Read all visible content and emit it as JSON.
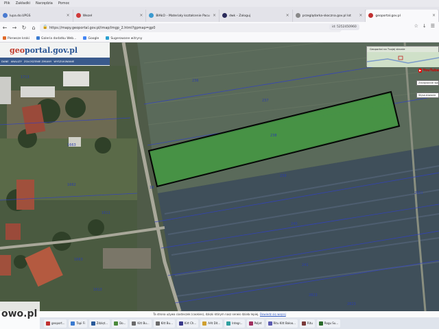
{
  "menubar": {
    "items": [
      "Plik",
      "Zakładki",
      "Narzędzia",
      "Pomoc"
    ]
  },
  "tabs": [
    {
      "label": "lupa.do.UPGS",
      "color": "#4a7bd0",
      "active": false
    },
    {
      "label": "Wezeł",
      "color": "#d03a3a",
      "active": false
    },
    {
      "label": "BIAŁO – Materiały kształcenie Pacu",
      "color": "#3a9ad0",
      "active": false
    },
    {
      "label": "dwk – Zaloguj",
      "color": "#2a2a5a",
      "active": false
    },
    {
      "label": "przeglądarka-skoczna.gov.pl lot",
      "color": "#888888",
      "active": false
    },
    {
      "label": "geoportal.gov.pl",
      "color": "#c03030",
      "active": true
    }
  ],
  "navbar": {
    "url": "https://mapy.geoportal.gov.pl/imap/Imgp_2.html?gpmap=gp0",
    "side_note": "id: 5252450960"
  },
  "bookmarks": [
    {
      "label": "Pierwsze kroki",
      "color": "#e06a2a"
    },
    {
      "label": "Galeria dodatku Web...",
      "color": "#3a7ad0"
    },
    {
      "label": "Google",
      "color": "#4285f4"
    },
    {
      "label": "Sugerowane witryny",
      "color": "#2aa0d0"
    }
  ],
  "geoportal": {
    "logo_prefix": "geo",
    "logo_main": "portal.gov.pl",
    "menu": [
      "DANE",
      "ANALIZY",
      "ZGŁOSZENIE ZMIANY",
      "WYSZUKIWANIE"
    ]
  },
  "overview": {
    "title": "Geoportal na Tvojej stronie"
  },
  "youtube": {
    "label": "YouTube"
  },
  "side_buttons": [
    "Zarządzanie warstwami",
    "Wyszukiwanie"
  ],
  "parcels": [
    {
      "id": "1713",
      "note": "left top"
    },
    {
      "id": "236"
    },
    {
      "id": "237"
    },
    {
      "id": "238"
    },
    {
      "id": "239"
    },
    {
      "id": "240"
    },
    {
      "id": "241"
    },
    {
      "id": "18"
    },
    {
      "id": "1662"
    },
    {
      "id": "1663"
    },
    {
      "id": "1611"
    },
    {
      "id": "1663"
    },
    {
      "id": "1613"
    },
    {
      "id": "2823"
    },
    {
      "id": "2823"
    },
    {
      "id": "2651"
    }
  ],
  "cookie": {
    "text": "Ta strona używa ciasteczek (cookies), dzięki którym nasz serwis działa lepiej.",
    "link": "Dowiedz się więcej"
  },
  "taskbar": [
    {
      "label": "geoport...",
      "color": "#c03030"
    },
    {
      "label": "Tapi Fi",
      "color": "#3a7ad0"
    },
    {
      "label": "Zdzięt...",
      "color": "#2a5a9a"
    },
    {
      "label": "Do...",
      "color": "#4a8a3a"
    },
    {
      "label": "Kitt Bu...",
      "color": "#6a6a6a"
    },
    {
      "label": "Kitt Bu...",
      "color": "#6a6a6a"
    },
    {
      "label": "Kirt Ch...",
      "color": "#3a3a8a"
    },
    {
      "label": "AAt Dit...",
      "color": "#d0a030"
    },
    {
      "label": "Integr...",
      "color": "#30a0a0"
    },
    {
      "label": "Poljet",
      "color": "#a03060"
    },
    {
      "label": "Ritu Kitt Baloo...",
      "color": "#5a5ab0"
    },
    {
      "label": "Ritu",
      "color": "#7a3a3a"
    },
    {
      "label": "Rogu Su...",
      "color": "#2a6a2a"
    }
  ],
  "watermark": "owo.pl"
}
